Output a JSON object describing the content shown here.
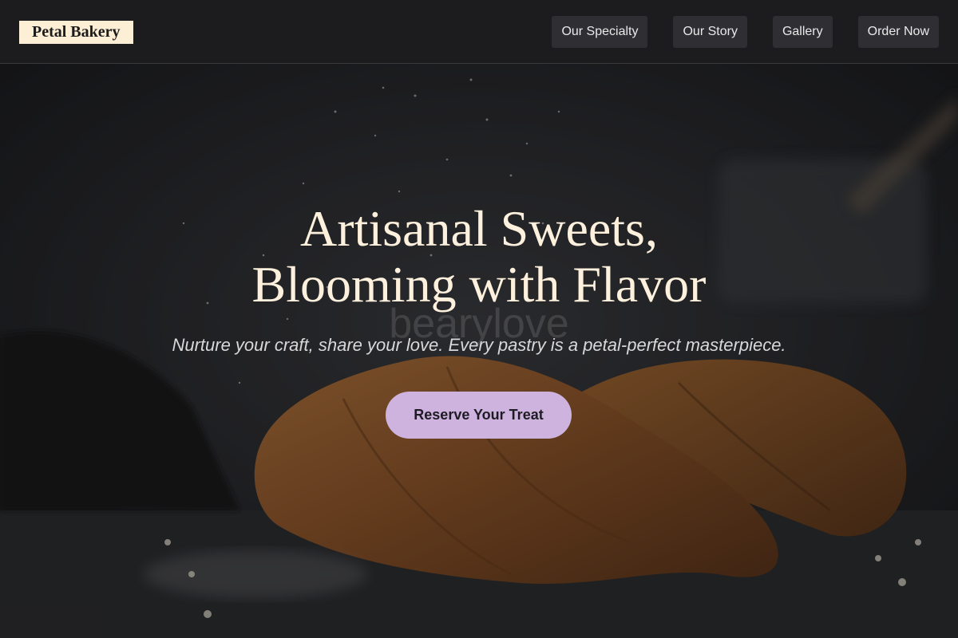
{
  "brand": {
    "name": "Petal Bakery"
  },
  "nav": {
    "items": [
      {
        "label": "Our Specialty"
      },
      {
        "label": "Our Story"
      },
      {
        "label": "Gallery"
      },
      {
        "label": "Order Now"
      }
    ]
  },
  "hero": {
    "headline_line1": "Artisanal Sweets,",
    "headline_line2": "Blooming with Flavor",
    "watermark": "bearylove",
    "subtitle": "Nurture your craft, share your love. Every pastry is a petal-perfect masterpiece.",
    "cta_label": "Reserve Your Treat"
  },
  "colors": {
    "header_bg": "#1c1c1e",
    "logo_bg": "#fdeed6",
    "nav_button_bg": "#2f2f33",
    "headline": "#fdf0dc",
    "cta_bg": "#cdb3dd"
  }
}
